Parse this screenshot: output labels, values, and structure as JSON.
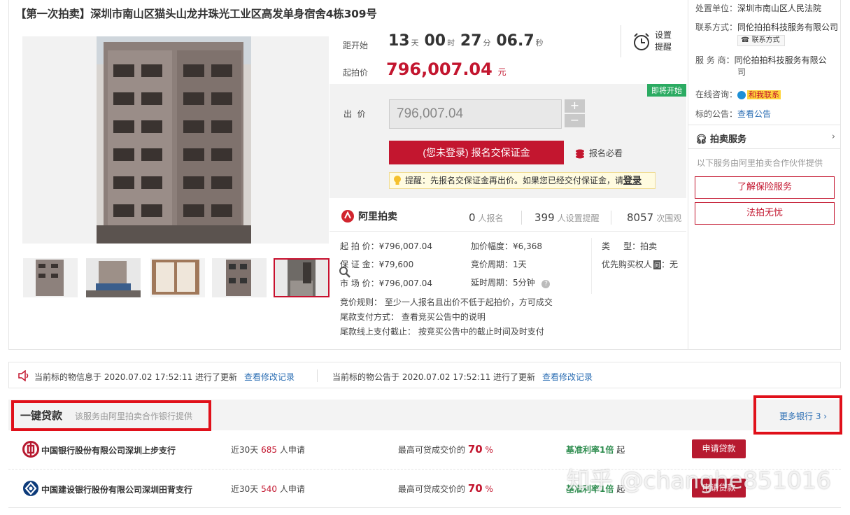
{
  "title": "【第一次拍卖】深圳市南山区猫头山龙井珠光工业区高发单身宿舍4栋309号",
  "countdown": {
    "label": "距开始",
    "days": "13",
    "days_unit": "天",
    "hours": "00",
    "hours_unit": "时",
    "minutes": "27",
    "minutes_unit": "分",
    "seconds": "06.7",
    "seconds_unit": "秒",
    "reminder_label_1": "设置",
    "reminder_label_2": "提醒"
  },
  "start_price": {
    "label": "起拍价",
    "value": "796,007.04",
    "unit": "元"
  },
  "bid": {
    "badge": "即将开始",
    "label": "出  价",
    "input_value": "796,007.04",
    "plus": "+",
    "minus": "−",
    "signup_button": "(您未登录) 报名交保证金",
    "must_read": "报名必看",
    "tip_text": "提醒：先报名交保证金再出价。如果您已经交付保证金，请",
    "tip_login": "登录"
  },
  "brand": "阿里拍卖",
  "stats": [
    {
      "num": "0",
      "label": "人报名"
    },
    {
      "num": "399",
      "label": "人设置提醒"
    },
    {
      "num": "8057",
      "label": "次围观"
    }
  ],
  "details": {
    "start_price": "起 拍 价：¥796,007.04",
    "deposit": "保 证 金：¥79,600",
    "market_price": "市 场 价：¥796,007.04",
    "increment": "加价幅度：¥6,368",
    "bid_period": "竞价周期：1天",
    "extension": "延时周期：5分钟",
    "type": "类     型：拍卖",
    "priority": "优先购买权人",
    "priority_tag": "问",
    "priority_value": "：无",
    "rule": "竞价规则： 至少一人报名且出价不低于起拍价，方可成交",
    "payment": "尾款支付方式： 查看竞买公告中的说明",
    "deadline": "尾款线上支付截止： 按竞买公告中的截止时间及时支付"
  },
  "side": {
    "court_label": "处置单位：",
    "court": "深圳市南山区人民法院",
    "contact_label": "联系方式：",
    "contact": "同伦拍拍科技服务有限公司",
    "contact_btn": "联系方式",
    "service_label": "服 务 商：",
    "service_1": "同伦拍拍科技服务有限公",
    "service_2": "司",
    "consult_label": "在线咨询：",
    "consult_btn": "和我联系",
    "notice_label": "标的公告：",
    "notice_link": "查看公告",
    "auction_service": "拍卖服务",
    "partner_note": "以下服务由阿里拍卖合作伙伴提供",
    "insurance_btn": "了解保险服务",
    "legal_btn": "法拍无忧"
  },
  "updates": {
    "info_text": "当前标的物信息于 2020.07.02 17:52:11 进行了更新",
    "info_link": "查看修改记录",
    "notice_text": "当前标的物公告于 2020.07.02 17:52:11 进行了更新",
    "notice_link": "查看修改记录"
  },
  "loan": {
    "title": "一键贷款",
    "subtitle": "该服务由阿里拍卖合作银行提供",
    "more": "更多银行 3",
    "rows": [
      {
        "bank": "中国银行股份有限公司深圳上步支行",
        "recent_pre": "近30天",
        "recent_num": "685",
        "recent_post": "人申请",
        "ratio_pre": "最高可贷成交价的",
        "ratio_num": "70",
        "ratio_unit": "%",
        "rate": "基准利率1倍",
        "rate_post": "起",
        "button": "申请贷款"
      },
      {
        "bank": "中国建设银行股份有限公司深圳田背支行",
        "recent_pre": "近30天",
        "recent_num": "540",
        "recent_post": "人申请",
        "ratio_pre": "最高可贷成交价的",
        "ratio_num": "70",
        "ratio_unit": "%",
        "rate": "基准利率1倍",
        "rate_post": "起",
        "button": "申请贷款"
      }
    ]
  },
  "watermark": "知乎 @changhe851016"
}
